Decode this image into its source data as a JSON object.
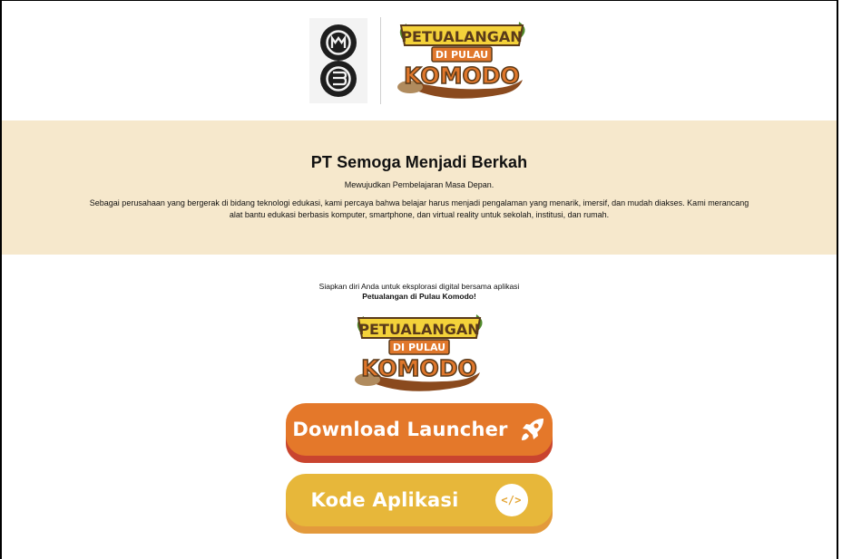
{
  "header": {
    "company_logo_text": "MB",
    "app_logo_lines": [
      "PETUALANGAN",
      "DI PULAU",
      "KOMODO"
    ]
  },
  "about": {
    "title": "PT Semoga Menjadi Berkah",
    "tagline": "Mewujudkan Pembelajaran Masa Depan.",
    "description_line1": "Sebagai perusahaan yang bergerak di bidang teknologi edukasi, kami percaya bahwa belajar harus menjadi pengalaman yang menarik, imersif, dan mudah diakses. Kami merancang",
    "description_line2": "alat bantu edukasi berbasis komputer, smartphone, dan virtual reality untuk sekolah, institusi, dan rumah."
  },
  "cta": {
    "lead": "Siapkan diri Anda untuk eksplorasi digital bersama aplikasi",
    "app_name": "Petualangan di Pulau Komodo!",
    "download_label": "Download Launcher",
    "download_icon": "rocket-icon",
    "kode_label": "Kode Aplikasi",
    "kode_icon": "code-icon",
    "kode_icon_glyph": "</>"
  },
  "colors": {
    "band_bg": "#f6e8cc",
    "download_btn": "#e4782a",
    "kode_btn": "#e7b73a",
    "logo_yellow": "#f4d23a",
    "logo_orange": "#e0772b",
    "logo_green": "#4f8a2a"
  }
}
